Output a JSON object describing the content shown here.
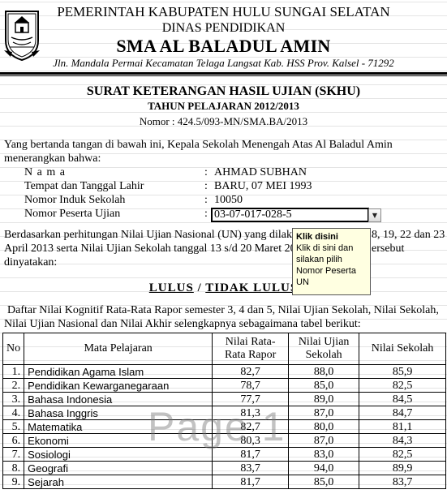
{
  "header": {
    "line1": "PEMERINTAH KABUPATEN HULU SUNGAI SELATAN",
    "line2": "DINAS PENDIDIKAN",
    "school": "SMA AL BALADUL AMIN",
    "address": "Jln. Mandala Permai Kecamatan Telaga Langsat Kab. HSS Prov. Kalsel - 71292"
  },
  "title": {
    "main": "SURAT KETERANGAN HASIL UJIAN (SKHU)",
    "year": "TAHUN PELAJARAN 2012/2013",
    "nomor": "Nomor : 424.5/093-MN/SMA.BA/2013"
  },
  "intro": {
    "line1": "Yang bertanda tangan di bawah ini,  Kepala Sekolah Menengah Atas Al Baladul Amin",
    "line2": "menerangkan bahwa:"
  },
  "fields": {
    "nama_label": "N a m a",
    "nama_value": "AHMAD SUBHAN",
    "ttl_label": "Tempat dan Tanggal Lahir",
    "ttl_value": "BARU, 07 MEI 1993",
    "nis_label": "Nomor Induk Sekolah",
    "nis_value": "10050",
    "nopes_label": "Nomor Peserta Ujian",
    "nopes_value": "03-07-017-028-5",
    "colon": ":"
  },
  "tooltip": {
    "title": "Klik disini",
    "body": "Klik di sini dan silakan pilih Nomor Peserta UN"
  },
  "body_text": {
    "line1a": "Berdasarkan perhitungan Nilai Ujian Nasional (UN) yang dilaks",
    "line1b": "8, 19, 22 dan 23",
    "line2a": "April 2013 serta Nilai Ujian Sekolah tanggal 13 s/d 20 Maret 20",
    "line2b": "ersebut",
    "line3": "dinyatakan:"
  },
  "status": {
    "lulus": "LULUS",
    "sep": " / ",
    "tidak": "TIDAK LULUS"
  },
  "table_intro": {
    "line1": "Daftar Nilai Kognitif Rata-Rata Rapor semester 3, 4 dan 5, Nilai Ujian Sekolah, Nilai Sekolah,",
    "line2": "Nilai Ujian Nasional dan Nilai Akhir selengkapnya sebagaimana tabel berikut:"
  },
  "table": {
    "headers": {
      "no": "No",
      "mapel": "Mata Pelajaran",
      "rapor": "Nilai Rata-Rata Rapor",
      "us": "Nilai Ujian Sekolah",
      "ns": "Nilai Sekolah"
    },
    "rows": [
      {
        "no": "1.",
        "mapel": "Pendidikan Agama Islam",
        "rapor": "82,7",
        "us": "88,0",
        "ns": "85,9"
      },
      {
        "no": "2.",
        "mapel": "Pendidikan Kewarganegaraan",
        "rapor": "78,7",
        "us": "85,0",
        "ns": "82,5"
      },
      {
        "no": "3.",
        "mapel": "Bahasa Indonesia",
        "rapor": "77,7",
        "us": "89,0",
        "ns": "84,5"
      },
      {
        "no": "4.",
        "mapel": "Bahasa Inggris",
        "rapor": "81,3",
        "us": "87,0",
        "ns": "84,7"
      },
      {
        "no": "5.",
        "mapel": "Matematika",
        "rapor": "82,7",
        "us": "80,0",
        "ns": "81,1"
      },
      {
        "no": "6.",
        "mapel": "Ekonomi",
        "rapor": "80,3",
        "us": "87,0",
        "ns": "84,3"
      },
      {
        "no": "7.",
        "mapel": "Sosiologi",
        "rapor": "81,7",
        "us": "83,0",
        "ns": "82,5"
      },
      {
        "no": "8.",
        "mapel": "Geografi",
        "rapor": "83,7",
        "us": "94,0",
        "ns": "89,9"
      },
      {
        "no": "9.",
        "mapel": "Sejarah",
        "rapor": "81,7",
        "us": "85,0",
        "ns": "83,7"
      }
    ]
  },
  "watermark": "Page 1",
  "icons": {
    "logo": "school-emblem-icon",
    "dropdown": "dropdown-arrow-icon"
  }
}
